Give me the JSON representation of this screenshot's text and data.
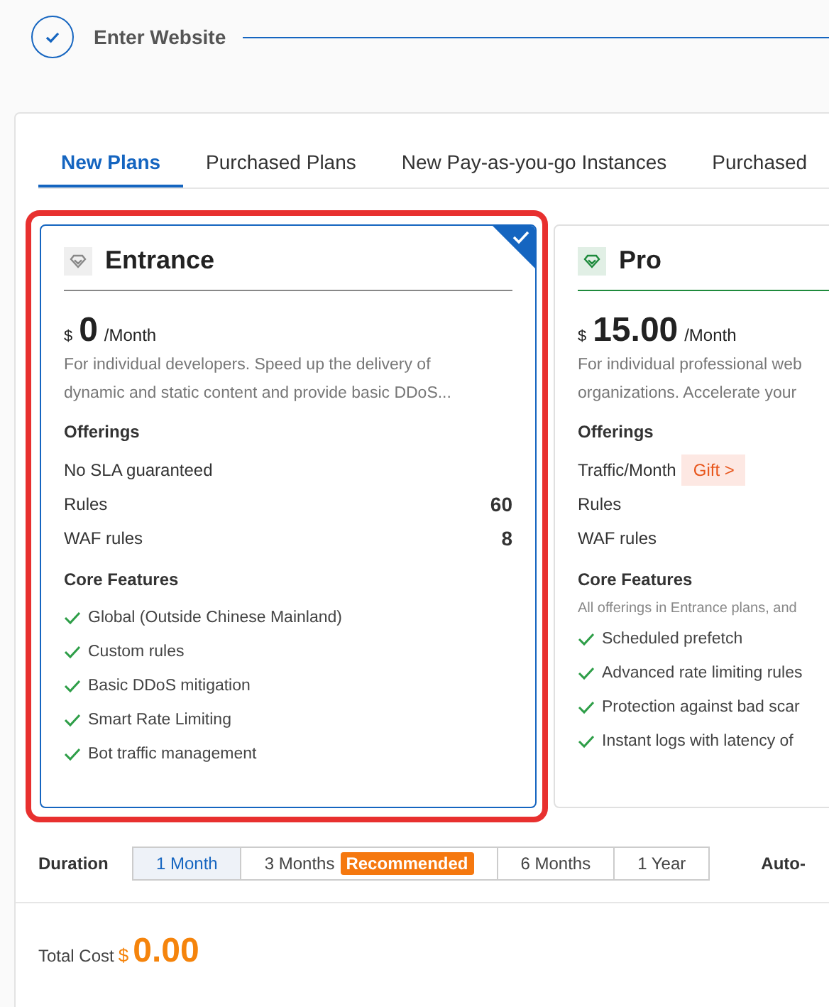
{
  "step": {
    "title": "Enter Website",
    "done": true
  },
  "tabs": [
    {
      "label": "New Plans",
      "selected": true
    },
    {
      "label": "Purchased Plans",
      "selected": false
    },
    {
      "label": "New Pay-as-you-go Instances",
      "selected": false
    },
    {
      "label": "Purchased",
      "selected": false
    }
  ],
  "plans": [
    {
      "name": "Entrance",
      "color": "#888888",
      "selected": true,
      "highlighted": true,
      "currency": "$",
      "price": "0",
      "period": "/Month",
      "description": [
        "For individual developers. Speed up the delivery of",
        "dynamic and static content and provide basic DDoS..."
      ],
      "offerings_title": "Offerings",
      "offerings": [
        {
          "label": "No SLA guaranteed"
        },
        {
          "label": "Rules",
          "value": "60"
        },
        {
          "label": "WAF rules",
          "value": "8"
        }
      ],
      "features_title": "Core Features",
      "features": [
        "Global (Outside Chinese Mainland)",
        "Custom rules",
        "Basic DDoS mitigation",
        "Smart Rate Limiting",
        "Bot traffic management"
      ]
    },
    {
      "name": "Pro",
      "color": "#1e8a3c",
      "selected": false,
      "highlighted": false,
      "currency": "$",
      "price": "15.00",
      "period": "/Month",
      "description": [
        "For individual professional web",
        "organizations. Accelerate your"
      ],
      "offerings_title": "Offerings",
      "offerings": [
        {
          "label": "Traffic/Month",
          "badge": "Gift >"
        },
        {
          "label": "Rules"
        },
        {
          "label": "WAF rules"
        }
      ],
      "features_title": "Core Features",
      "features_note": "All offerings in Entrance plans, and",
      "features": [
        "Scheduled prefetch",
        "Advanced rate limiting rules",
        "Protection against bad scar",
        "Instant logs with latency of"
      ]
    }
  ],
  "duration": {
    "label": "Duration",
    "options": [
      {
        "label": "1 Month",
        "selected": true
      },
      {
        "label": "3 Months",
        "badge": "Recommended",
        "selected": false
      },
      {
        "label": "6 Months",
        "selected": false
      },
      {
        "label": "1 Year",
        "selected": false
      }
    ],
    "next_label": "Auto-"
  },
  "total": {
    "label": "Total Cost",
    "currency": "$",
    "amount": "0.00"
  }
}
